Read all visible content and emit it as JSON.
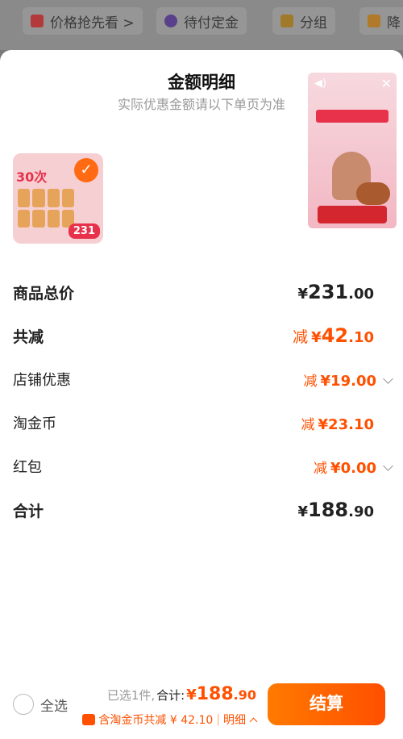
{
  "topbar": {
    "chips": [
      {
        "label": "价格抢先看 >",
        "icon": "ticket-icon"
      },
      {
        "label": "待付定金",
        "icon": "clock-icon"
      },
      {
        "label": "分组",
        "icon": "folder-icon"
      },
      {
        "label": "降",
        "icon": "down-arrow-icon"
      }
    ]
  },
  "sheet": {
    "title": "金额明细",
    "subtitle": "实际优惠金额请以下单页为准",
    "product_thumb": {
      "badge_num": "231",
      "tag": "30次"
    }
  },
  "rows": {
    "total_price": {
      "label": "商品总价",
      "yen": "¥",
      "int": "231",
      "dec": ".00"
    },
    "total_discount": {
      "label": "共减",
      "prefix": "减",
      "yen": "¥",
      "int": "42",
      "dec": ".10"
    },
    "shop_discount": {
      "label": "店铺优惠",
      "prefix": "减",
      "yen": "¥",
      "int": "19",
      "dec": ".00"
    },
    "taojinbi": {
      "label": "淘金币",
      "prefix": "减",
      "yen": "¥",
      "int": "23",
      "dec": ".10"
    },
    "redpacket": {
      "label": "红包",
      "prefix": "减",
      "yen": "¥",
      "int": "0",
      "dec": ".00"
    },
    "final_total": {
      "label": "合计",
      "yen": "¥",
      "int": "188",
      "dec": ".90"
    }
  },
  "bottom": {
    "select_all": "全选",
    "selected": "已选1件,",
    "total_label": "合计:",
    "yen": "¥",
    "amount_int": "188",
    "amount_dec": ".90",
    "detail_text": "含淘金币共减 ¥ 42.10",
    "detail_sep": "|",
    "detail_link": "明细",
    "settle_label": "结算"
  },
  "colors": {
    "accent": "#ff5000",
    "overlay": "#7a7a7a"
  }
}
